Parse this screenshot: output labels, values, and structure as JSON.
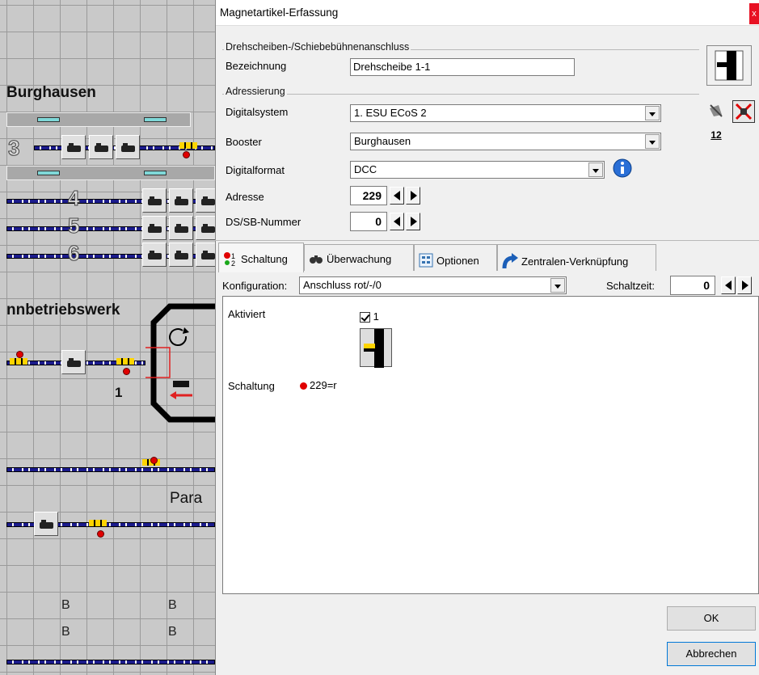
{
  "layout": {
    "station_label": "Burghausen",
    "depot_label": "nnbetriebswerk",
    "para_label": "Para",
    "track_numbers": [
      "3",
      "4",
      "5",
      "6"
    ],
    "track_one": "1",
    "b_letters": [
      "B",
      "B",
      "B",
      "B"
    ]
  },
  "dialog": {
    "title": "Magnetartikel-Erfassung",
    "close_glyph": "x",
    "section_connection": {
      "legend": "Drehscheiben-/Schiebebühnenanschluss",
      "name_label": "Bezeichnung",
      "name_value": "Drehscheibe 1-1"
    },
    "section_addressing": {
      "legend": "Adressierung",
      "digital_system_label": "Digitalsystem",
      "digital_system_value": "1. ESU ECoS 2",
      "booster_label": "Booster",
      "booster_value": "Burghausen",
      "format_label": "Digitalformat",
      "format_value": "DCC",
      "address_label": "Adresse",
      "address_value": "229",
      "ds_sb_label": "DS/SB-Nummer",
      "ds_sb_value": "0",
      "num_icon_label": "12"
    },
    "tabs": [
      {
        "label": "Schaltung",
        "icon": "switching-icon"
      },
      {
        "label": "Überwachung",
        "icon": "binoculars-icon"
      },
      {
        "label": "Optionen",
        "icon": "options-icon"
      },
      {
        "label": "Zentralen-Verknüpfung",
        "icon": "link-arrow-icon"
      }
    ],
    "config": {
      "label": "Konfiguration:",
      "value": "Anschluss rot/-/0",
      "switch_time_label": "Schaltzeit:",
      "switch_time_value": "0"
    },
    "panel": {
      "activated_label": "Aktiviert",
      "activated_checkbox_label": "1",
      "switching_label": "Schaltung",
      "switching_value": "229=r"
    },
    "buttons": {
      "ok": "OK",
      "cancel": "Abbrechen"
    }
  }
}
